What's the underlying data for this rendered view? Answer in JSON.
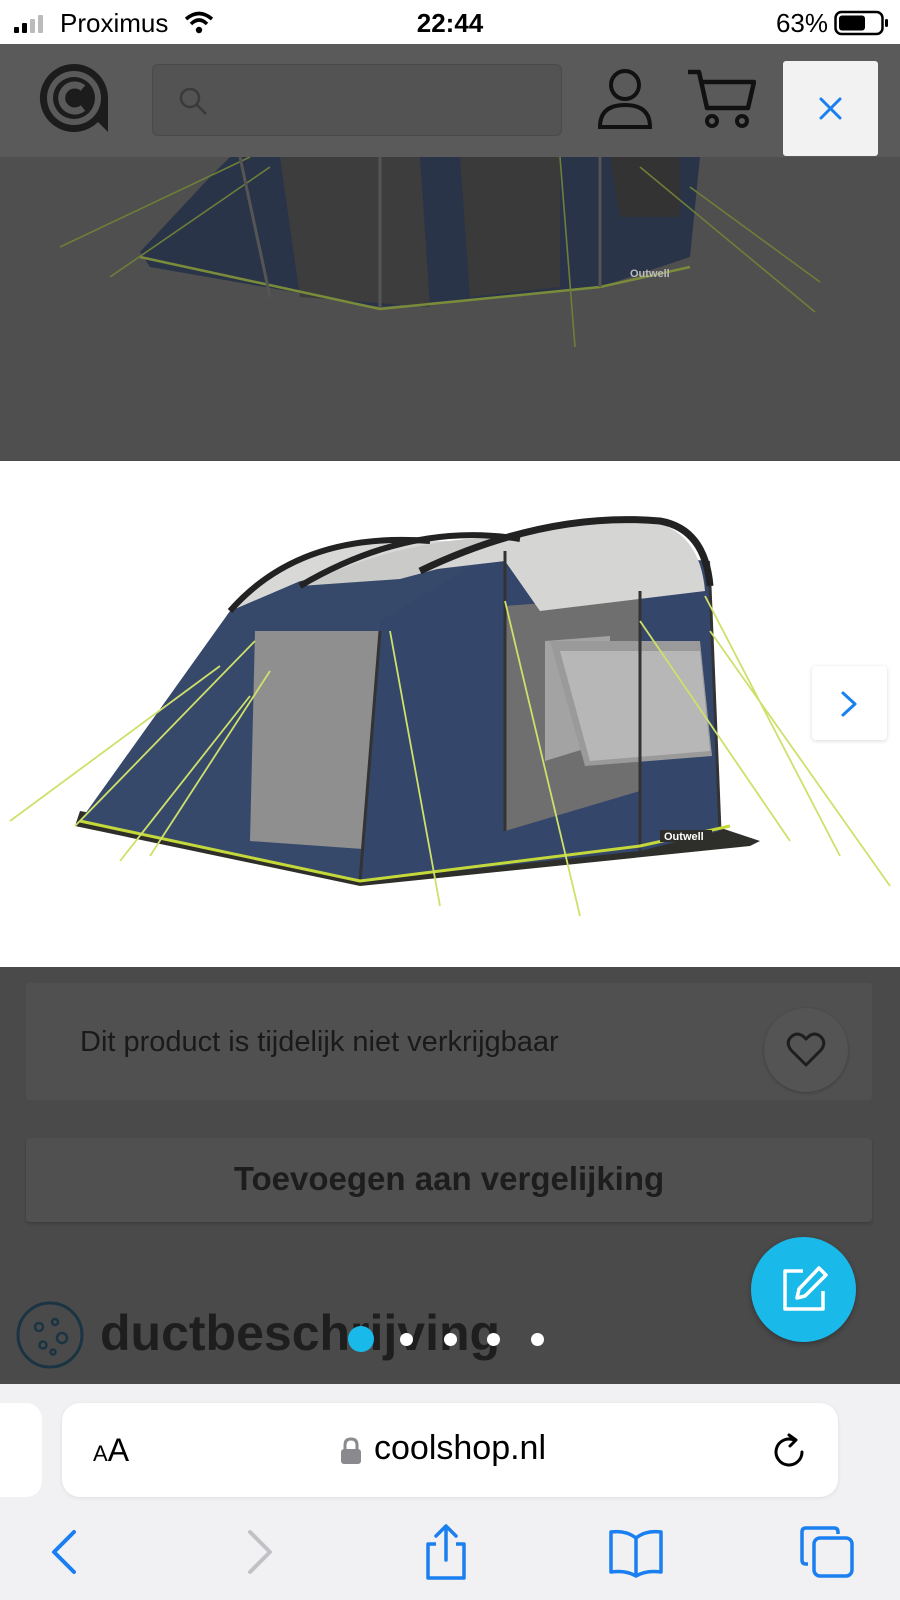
{
  "status_bar": {
    "carrier": "Proximus",
    "time": "22:44",
    "battery": "63%"
  },
  "header": {
    "search_placeholder": ""
  },
  "gallery": {
    "brand_mark": "Outwell",
    "active_index": 0,
    "total": 5
  },
  "product": {
    "availability": "Dit product is tijdelijk niet verkrijgbaar",
    "compare_label": "Toevoegen aan vergelijking",
    "section_title": "ductbeschrijving"
  },
  "safari": {
    "text_size_label": "AA",
    "url": "coolshop.nl"
  },
  "colors": {
    "accent": "#19b9ea",
    "dim_overlay": "#4a4a4a",
    "link_blue": "#1a7ff0"
  }
}
